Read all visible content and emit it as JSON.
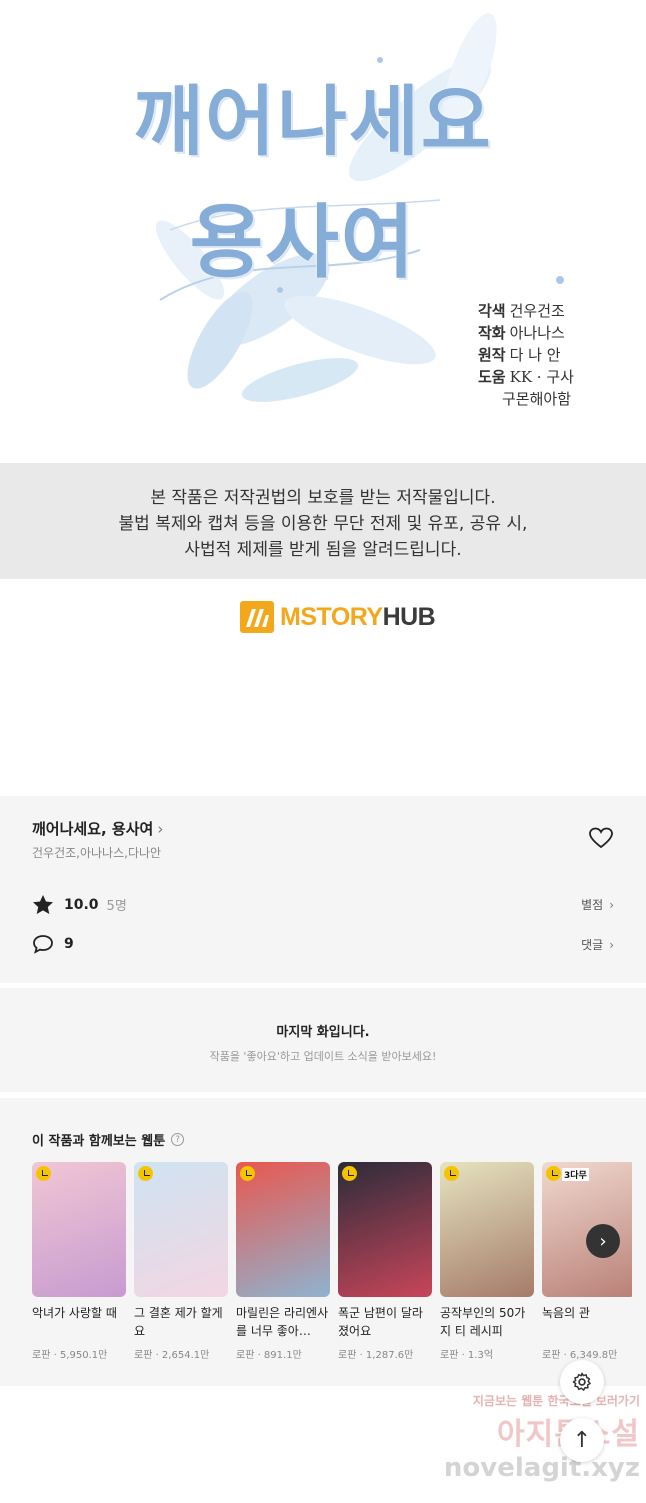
{
  "cover": {
    "title_line1": "깨어나세요",
    "title_line2": "용사여",
    "credits": [
      {
        "role": "각색",
        "name": "건우건조"
      },
      {
        "role": "작화",
        "name": "아나나스"
      },
      {
        "role": "원작",
        "name": "다 나 안"
      },
      {
        "role": "도움",
        "name": "KK · 구사"
      }
    ],
    "credits_extra": "구몬해아함"
  },
  "notice": {
    "line1": "본 작품은 저작권법의 보호를 받는 저작물입니다.",
    "line2": "불법 복제와 캡쳐 등을 이용한 무단 전제 및 유포, 공유 시,",
    "line3": "사법적 제제를 받게 됨을 알려드립니다."
  },
  "logo": {
    "part1": "MSTORY",
    "part2": "HUB"
  },
  "info": {
    "title": "깨어나세요, 용사여",
    "authors": "건우건조,아나나스,다나안",
    "rating": "10.0",
    "rating_count": "5명",
    "rating_link": "별점",
    "comment_count": "9",
    "comment_link": "댓글"
  },
  "last_episode": {
    "title": "마지막 화입니다.",
    "subtitle": "작품을 '좋아요'하고 업데이트 소식을 받아보세요!"
  },
  "recommendations": {
    "heading": "이 작품과 함께보는 웹툰",
    "items": [
      {
        "title": "악녀가 사랑할 때",
        "meta": "로판 · 5,950.1만",
        "tag": "",
        "colors": [
          "#f1c6d4",
          "#c79bd0"
        ]
      },
      {
        "title": "그 결혼 제가 할게요",
        "meta": "로판 · 2,654.1만",
        "tag": "",
        "colors": [
          "#cfe3f2",
          "#f3d6e2"
        ]
      },
      {
        "title": "마릴린은 라리엔사를 너무 좋아…",
        "meta": "로판 · 891.1만",
        "tag": "",
        "colors": [
          "#e9574f",
          "#8fb3cf"
        ]
      },
      {
        "title": "폭군 남편이 달라졌어요",
        "meta": "로판 · 1,287.6만",
        "tag": "",
        "colors": [
          "#2b2c3a",
          "#c9455a"
        ]
      },
      {
        "title": "공작부인의 50가지 티 레시피",
        "meta": "로판 · 1.3억",
        "tag": "",
        "colors": [
          "#e5e3bf",
          "#a57b6a"
        ]
      },
      {
        "title": "녹음의 관",
        "meta": "로판 · 6,349.8만",
        "tag": "3다무",
        "colors": [
          "#f0d9cf",
          "#b98077"
        ]
      }
    ]
  },
  "watermark": {
    "line1": "지금보는 웹툰 한국소설 보러가기",
    "line2": "아지툰소설",
    "line3": "novelagit.xyz"
  },
  "icons": {
    "star": "star-icon",
    "comment": "comment-icon",
    "heart": "heart-icon",
    "settings": "gear-icon",
    "top": "arrow-up-icon",
    "next": "chevron-right-icon",
    "help": "question-icon"
  }
}
